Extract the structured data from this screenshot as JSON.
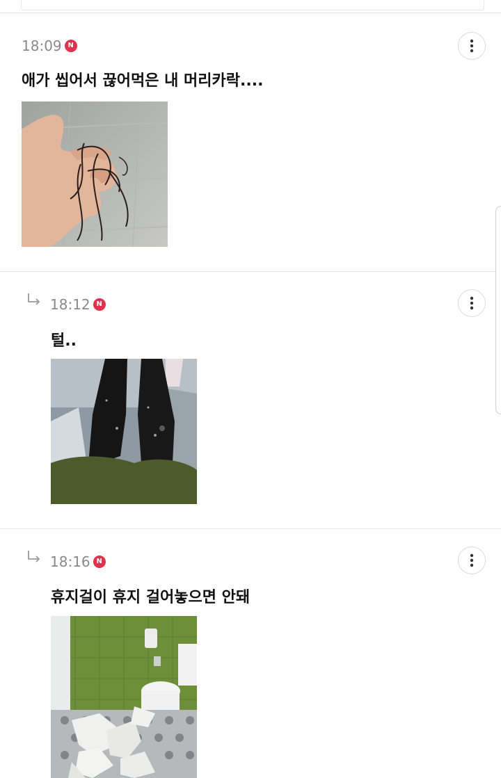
{
  "comments": [
    {
      "time": "18:09",
      "badge": "N",
      "text": "애가 씹어서 끊어먹은 내 머리카락....",
      "is_reply": false,
      "photo_icon": "hair-in-hand-photo"
    },
    {
      "time": "18:12",
      "badge": "N",
      "text": "털..",
      "is_reply": true,
      "photo_icon": "fuzzy-leggings-photo"
    },
    {
      "time": "18:16",
      "badge": "N",
      "text": "휴지걸이 휴지 걸어놓으면 안돼",
      "is_reply": true,
      "photo_icon": "shredded-toilet-paper-photo"
    }
  ],
  "colors": {
    "new_badge": "#e0324b",
    "time_text": "#8a8a8a",
    "divider": "#e7e7e7"
  }
}
